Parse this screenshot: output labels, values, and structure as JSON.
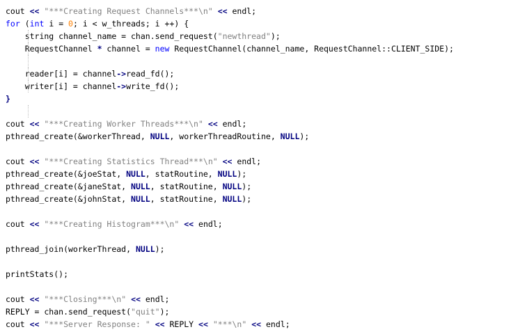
{
  "colors": {
    "background": "#ffffff",
    "plain": "#000000",
    "string": "#808080",
    "keyword": "#0000ff",
    "number": "#ff8000",
    "operator": "#000080"
  },
  "lines": [
    {
      "guide": false,
      "tokens": [
        [
          "plain",
          "cout "
        ],
        [
          "op",
          "<<"
        ],
        [
          "plain",
          " "
        ],
        [
          "string",
          "\"***Creating Request Channels***\\n\""
        ],
        [
          "plain",
          " "
        ],
        [
          "op",
          "<<"
        ],
        [
          "plain",
          " endl;"
        ]
      ]
    },
    {
      "guide": false,
      "tokens": [
        [
          "keyword",
          "for"
        ],
        [
          "plain",
          " ("
        ],
        [
          "keyword",
          "int"
        ],
        [
          "plain",
          " i = "
        ],
        [
          "number",
          "0"
        ],
        [
          "plain",
          "; i < w_threads; i ++) {"
        ]
      ]
    },
    {
      "guide": true,
      "tokens": [
        [
          "plain",
          "    string channel_name = chan.send_request("
        ],
        [
          "string",
          "\"newthread\""
        ],
        [
          "plain",
          ");"
        ]
      ]
    },
    {
      "guide": true,
      "tokens": [
        [
          "plain",
          "    RequestChannel "
        ],
        [
          "op",
          "*"
        ],
        [
          "plain",
          " channel = "
        ],
        [
          "keyword",
          "new"
        ],
        [
          "plain",
          " RequestChannel(channel_name, RequestChannel::CLIENT_SIDE);"
        ]
      ]
    },
    {
      "guide": true,
      "tokens": []
    },
    {
      "guide": true,
      "tokens": [
        [
          "plain",
          "    reader[i] = channel"
        ],
        [
          "op",
          "->"
        ],
        [
          "plain",
          "read_fd();"
        ]
      ]
    },
    {
      "guide": true,
      "tokens": [
        [
          "plain",
          "    writer[i] = channel"
        ],
        [
          "op",
          "->"
        ],
        [
          "plain",
          "write_fd();"
        ]
      ]
    },
    {
      "guide": false,
      "tokens": [
        [
          "op",
          "}"
        ]
      ]
    },
    {
      "guide": true,
      "tokens": []
    },
    {
      "guide": false,
      "tokens": [
        [
          "plain",
          "cout "
        ],
        [
          "op",
          "<<"
        ],
        [
          "plain",
          " "
        ],
        [
          "string",
          "\"***Creating Worker Threads***\\n\""
        ],
        [
          "plain",
          " "
        ],
        [
          "op",
          "<<"
        ],
        [
          "plain",
          " endl;"
        ]
      ]
    },
    {
      "guide": false,
      "tokens": [
        [
          "plain",
          "pthread_create(&workerThread, "
        ],
        [
          "null",
          "NULL"
        ],
        [
          "plain",
          ", workerThreadRoutine, "
        ],
        [
          "null",
          "NULL"
        ],
        [
          "plain",
          ");"
        ]
      ]
    },
    {
      "guide": false,
      "tokens": []
    },
    {
      "guide": false,
      "tokens": [
        [
          "plain",
          "cout "
        ],
        [
          "op",
          "<<"
        ],
        [
          "plain",
          " "
        ],
        [
          "string",
          "\"***Creating Statistics Thread***\\n\""
        ],
        [
          "plain",
          " "
        ],
        [
          "op",
          "<<"
        ],
        [
          "plain",
          " endl;"
        ]
      ]
    },
    {
      "guide": false,
      "tokens": [
        [
          "plain",
          "pthread_create(&joeStat, "
        ],
        [
          "null",
          "NULL"
        ],
        [
          "plain",
          ", statRoutine, "
        ],
        [
          "null",
          "NULL"
        ],
        [
          "plain",
          ");"
        ]
      ]
    },
    {
      "guide": false,
      "tokens": [
        [
          "plain",
          "pthread_create(&janeStat, "
        ],
        [
          "null",
          "NULL"
        ],
        [
          "plain",
          ", statRoutine, "
        ],
        [
          "null",
          "NULL"
        ],
        [
          "plain",
          ");"
        ]
      ]
    },
    {
      "guide": false,
      "tokens": [
        [
          "plain",
          "pthread_create(&johnStat, "
        ],
        [
          "null",
          "NULL"
        ],
        [
          "plain",
          ", statRoutine, "
        ],
        [
          "null",
          "NULL"
        ],
        [
          "plain",
          ");"
        ]
      ]
    },
    {
      "guide": false,
      "tokens": []
    },
    {
      "guide": false,
      "tokens": [
        [
          "plain",
          "cout "
        ],
        [
          "op",
          "<<"
        ],
        [
          "plain",
          " "
        ],
        [
          "string",
          "\"***Creating Histogram***\\n\""
        ],
        [
          "plain",
          " "
        ],
        [
          "op",
          "<<"
        ],
        [
          "plain",
          " endl;"
        ]
      ]
    },
    {
      "guide": false,
      "tokens": []
    },
    {
      "guide": false,
      "tokens": [
        [
          "plain",
          "pthread_join(workerThread, "
        ],
        [
          "null",
          "NULL"
        ],
        [
          "plain",
          ");"
        ]
      ]
    },
    {
      "guide": false,
      "tokens": []
    },
    {
      "guide": false,
      "tokens": [
        [
          "plain",
          "printStats();"
        ]
      ]
    },
    {
      "guide": false,
      "tokens": []
    },
    {
      "guide": false,
      "tokens": [
        [
          "plain",
          "cout "
        ],
        [
          "op",
          "<<"
        ],
        [
          "plain",
          " "
        ],
        [
          "string",
          "\"***Closing***\\n\""
        ],
        [
          "plain",
          " "
        ],
        [
          "op",
          "<<"
        ],
        [
          "plain",
          " endl;"
        ]
      ]
    },
    {
      "guide": false,
      "tokens": [
        [
          "plain",
          "REPLY = chan.send_request("
        ],
        [
          "string",
          "\"quit\""
        ],
        [
          "plain",
          ");"
        ]
      ]
    },
    {
      "guide": false,
      "tokens": [
        [
          "plain",
          "cout "
        ],
        [
          "op",
          "<<"
        ],
        [
          "plain",
          " "
        ],
        [
          "string",
          "\"***Server Response: \""
        ],
        [
          "plain",
          " "
        ],
        [
          "op",
          "<<"
        ],
        [
          "plain",
          " REPLY "
        ],
        [
          "op",
          "<<"
        ],
        [
          "plain",
          " "
        ],
        [
          "string",
          "\"***\\n\""
        ],
        [
          "plain",
          " "
        ],
        [
          "op",
          "<<"
        ],
        [
          "plain",
          " endl;"
        ]
      ]
    }
  ]
}
